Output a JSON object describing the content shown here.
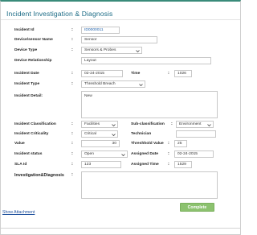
{
  "dialog": {
    "title": "Incident Investigation & Diagnosis"
  },
  "labels": {
    "incident_id": "Incident Id",
    "device_sensor_name": "Device/sensor Name",
    "device_type": "Device Type",
    "device_relationship": "Device Relationship",
    "incident_date": "Incident Date",
    "time": "Time",
    "incident_type": "Incident Type",
    "incident_detail": "Incident Detail:",
    "incident_classification": "Incident Classification",
    "sub_classification": "Sub-classification",
    "incident_criticality": "Incident Criticality",
    "technician": "Technician",
    "value": "Value",
    "threshold_value": "Threshhold Value",
    "incident_status": "Incident status",
    "assigned_date": "Assigned Date",
    "sla_id": "SLA Id",
    "assigned_time": "Assigned Time",
    "investigation_diagnosis": "Investigation&Diagnosis"
  },
  "values": {
    "incident_id": "ID0000011",
    "device_sensor_name": "Sensor",
    "device_type": "Sensors & Probes",
    "device_relationship": "Layout",
    "incident_date": "02-24-2015",
    "time": "1026",
    "incident_type": "Threshold Breach",
    "incident_detail": "New",
    "incident_classification": "Facilities",
    "sub_classification": "Environment",
    "incident_criticality": "Critical",
    "technician": "",
    "value": "30",
    "threshold_value": "25",
    "incident_status": "Open",
    "assigned_date": "02-24-2015",
    "sla_id": "123",
    "assigned_time": "1529",
    "investigation_diagnosis": ""
  },
  "actions": {
    "complete_label": "Complete",
    "show_attachment_label": "Show Attachment"
  },
  "colors": {
    "title": "#1d6c86",
    "button": "#8cc26f",
    "link": "#1d4f9c"
  }
}
